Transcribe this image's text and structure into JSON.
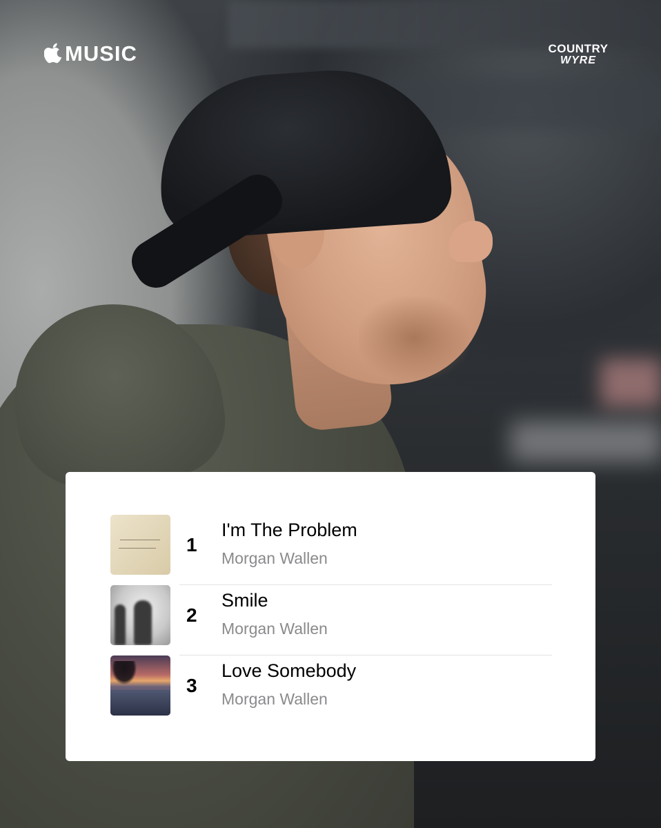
{
  "header": {
    "service_logo_text": "MUSIC",
    "publisher_logo_line1": "COUNTRY",
    "publisher_logo_line2": "WYRE"
  },
  "chart": {
    "tracks": [
      {
        "rank": "1",
        "title": "I'm The Problem",
        "artist": "Morgan Wallen",
        "artwork": "album-art-im-the-problem"
      },
      {
        "rank": "2",
        "title": "Smile",
        "artist": "Morgan Wallen",
        "artwork": "album-art-smile"
      },
      {
        "rank": "3",
        "title": "Love Somebody",
        "artist": "Morgan Wallen",
        "artwork": "album-art-love-somebody"
      }
    ]
  },
  "colors": {
    "card_background": "#ffffff",
    "title_text": "#000000",
    "artist_text": "#8a8a8e",
    "logo_text": "#ffffff"
  }
}
